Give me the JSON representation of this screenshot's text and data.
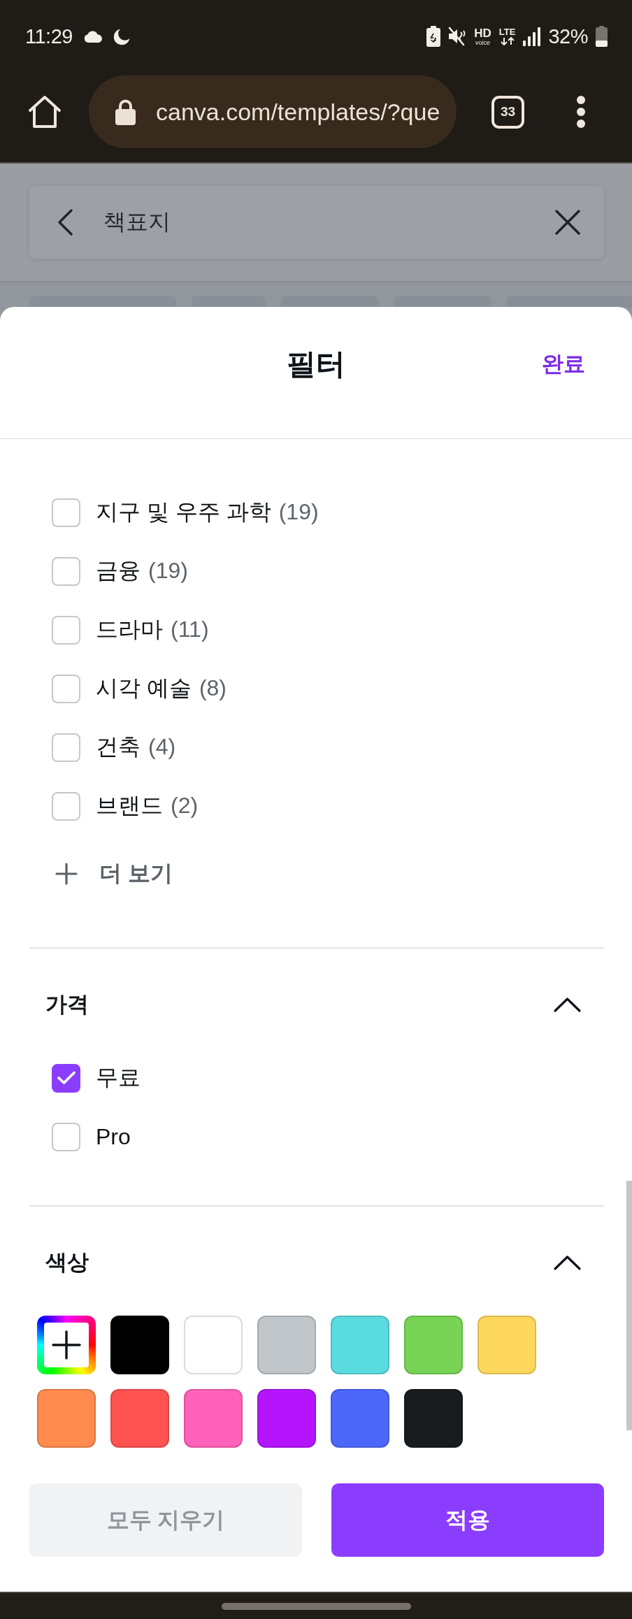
{
  "status_bar": {
    "time": "11:29",
    "hd": "HD",
    "voice": "voice",
    "lte": "LTE",
    "battery": "32%"
  },
  "browser": {
    "url": "canva.com/templates/?que",
    "tab_count": "33"
  },
  "search": {
    "value": "책표지"
  },
  "filter_sheet": {
    "title": "필터",
    "done": "완료",
    "topics": [
      {
        "label": "지구 및 우주 과학",
        "count": "(19)",
        "checked": false
      },
      {
        "label": "금융",
        "count": "(19)",
        "checked": false
      },
      {
        "label": "드라마",
        "count": "(11)",
        "checked": false
      },
      {
        "label": "시각 예술",
        "count": "(8)",
        "checked": false
      },
      {
        "label": "건축",
        "count": "(4)",
        "checked": false
      },
      {
        "label": "브랜드",
        "count": "(2)",
        "checked": false
      }
    ],
    "show_more": "더 보기",
    "sections": [
      {
        "kind": "checkboxes",
        "title": "가격",
        "expanded": true,
        "options": [
          {
            "label": "무료",
            "checked": true
          },
          {
            "label": "Pro",
            "checked": false
          }
        ]
      },
      {
        "kind": "colors",
        "title": "색상",
        "expanded": true,
        "swatches": [
          {
            "kind": "picker"
          },
          {
            "kind": "color",
            "color": "#000000"
          },
          {
            "kind": "color",
            "color": "#ffffff"
          },
          {
            "kind": "color",
            "color": "#c1c6cb"
          },
          {
            "kind": "color",
            "color": "#5adbe0"
          },
          {
            "kind": "color",
            "color": "#77d455"
          },
          {
            "kind": "color",
            "color": "#fdd85c"
          },
          {
            "kind": "color",
            "color": "#ff8b4e"
          },
          {
            "kind": "color",
            "color": "#ff5352"
          },
          {
            "kind": "color",
            "color": "#ff62b9"
          },
          {
            "kind": "color",
            "color": "#b515fd"
          },
          {
            "kind": "color",
            "color": "#4d67fb"
          },
          {
            "kind": "color",
            "color": "#191c1f"
          }
        ]
      }
    ],
    "actions": {
      "clear": {
        "label": "모두 지우기",
        "disabled": true
      },
      "apply": {
        "label": "적용"
      }
    }
  }
}
